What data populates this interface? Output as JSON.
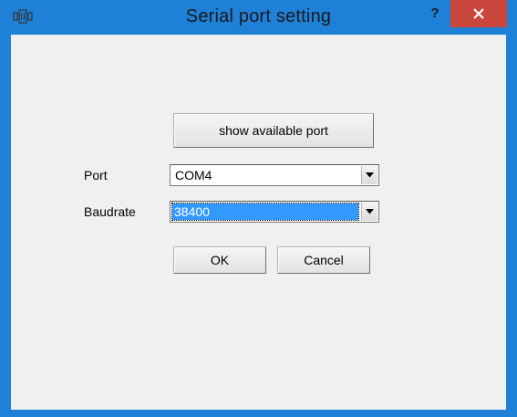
{
  "window": {
    "title": "Serial port setting",
    "help_label": "?"
  },
  "actions": {
    "show_ports_label": "show available port",
    "ok_label": "OK",
    "cancel_label": "Cancel"
  },
  "form": {
    "port": {
      "label": "Port",
      "value": "COM4"
    },
    "baudrate": {
      "label": "Baudrate",
      "value": "38400"
    }
  },
  "icons": {
    "app": "serial-port-icon",
    "close": "close-icon",
    "dropdown": "chevron-down-icon"
  },
  "colors": {
    "titlebar": "#1f80d8",
    "close_button": "#c9463d",
    "client_background": "#f0f0f0",
    "selection": "#3399ff"
  }
}
